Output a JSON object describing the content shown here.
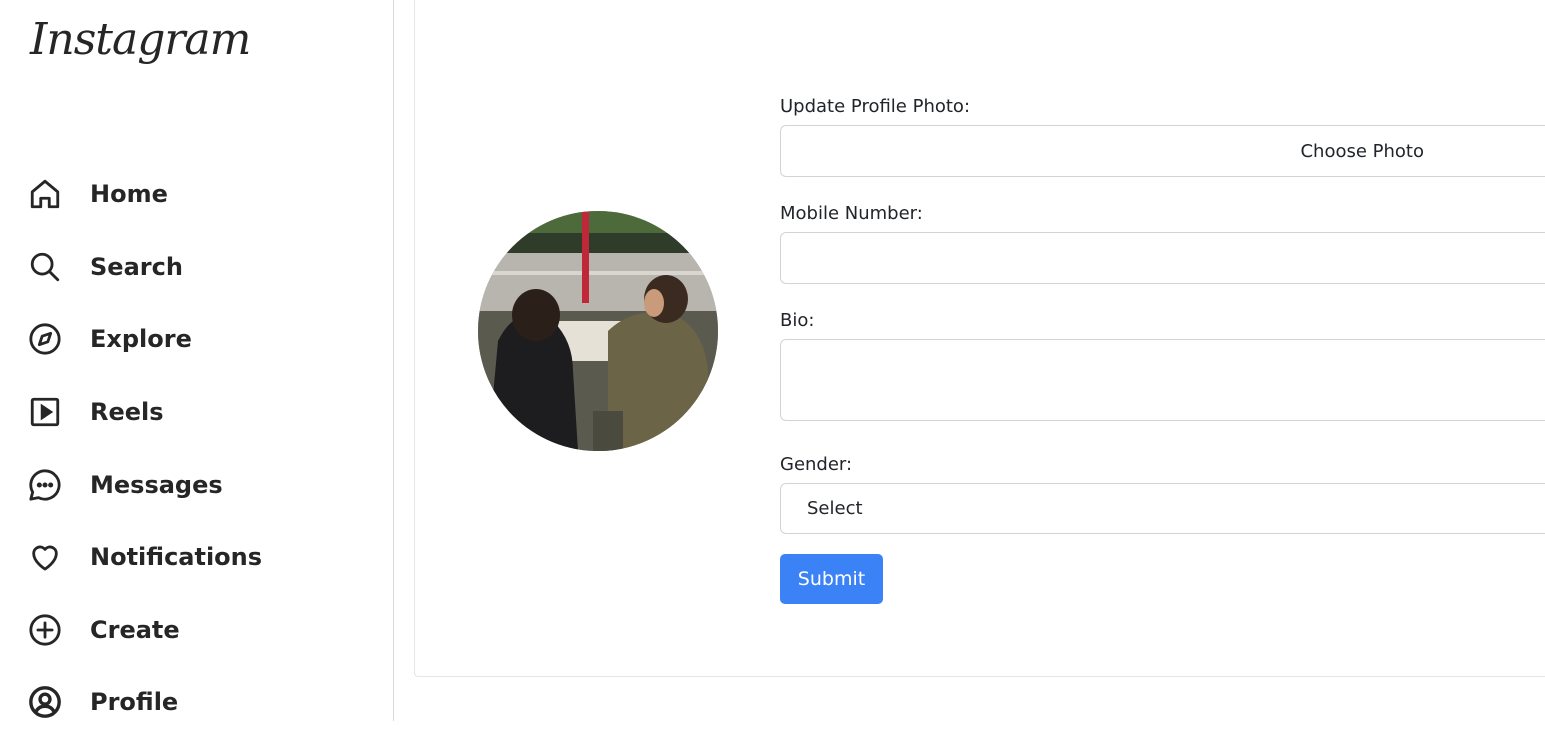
{
  "app": {
    "logo_text": "Instagram"
  },
  "sidebar": {
    "items": [
      {
        "label": "Home",
        "icon": "home-icon"
      },
      {
        "label": "Search",
        "icon": "search-icon"
      },
      {
        "label": "Explore",
        "icon": "compass-icon"
      },
      {
        "label": "Reels",
        "icon": "reels-icon"
      },
      {
        "label": "Messages",
        "icon": "chat-bubble-icon"
      },
      {
        "label": "Notifications",
        "icon": "heart-icon"
      },
      {
        "label": "Create",
        "icon": "plus-circle-icon"
      },
      {
        "label": "Profile",
        "icon": "user-circle-icon",
        "active": true
      }
    ]
  },
  "form": {
    "photo_label": "Update Profile Photo:",
    "photo_button": "Choose Photo",
    "mobile_label": "Mobile Number:",
    "mobile_value": "",
    "bio_label": "Bio:",
    "bio_value": "",
    "gender_label": "Gender:",
    "gender_selected": "Select",
    "submit_label": "Submit"
  },
  "colors": {
    "accent": "#3b82f6",
    "text": "#262626",
    "border": "#ced4da"
  }
}
